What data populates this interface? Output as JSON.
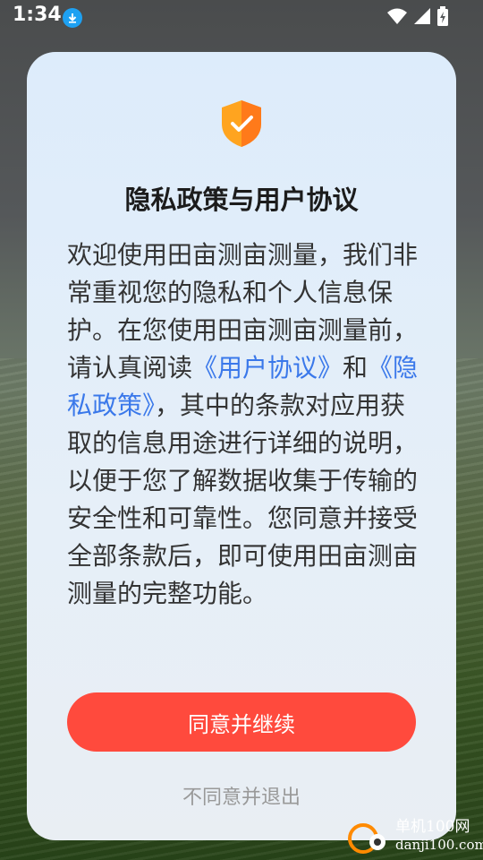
{
  "status_bar": {
    "time": "1:34",
    "icons": [
      "download-icon",
      "wifi-icon",
      "signal-icon",
      "battery-icon"
    ]
  },
  "dialog": {
    "icon": "shield-check-icon",
    "title": "隐私政策与用户协议",
    "body": {
      "part1": "欢迎使用田亩测亩测量，我们非常重视您的隐私和个人信息保护。在您使用田亩测亩测量前，请认真阅读",
      "link_user_agreement": "《用户协议》",
      "part2": "和",
      "link_privacy_policy": "《隐私政策》",
      "part3": "，其中的条款对应用获取的信息用途进行详细的说明，以便于您了解数据收集于传输的安全性和可靠性。您同意并接受全部条款后，即可使用田亩测亩测量的完整功能。"
    },
    "agree_button": "同意并继续",
    "disagree_link": "不同意并退出"
  },
  "watermark": {
    "name": "单机100网",
    "url": "danji100.com"
  },
  "colors": {
    "accent": "#ff4a3d",
    "link": "#3a78ea",
    "shield": "#ffa41f"
  }
}
